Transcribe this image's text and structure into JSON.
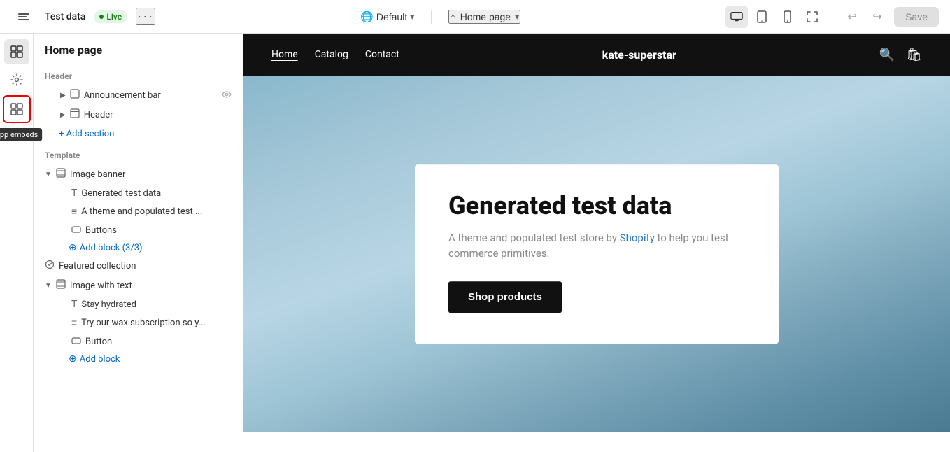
{
  "topbar": {
    "app_name": "Test data",
    "live_label": "Live",
    "more_label": "...",
    "default_label": "Default",
    "home_page_label": "Home page",
    "save_label": "Save"
  },
  "sidebar_icons": [
    {
      "name": "sections-icon",
      "symbol": "⊞",
      "tooltip": null
    },
    {
      "name": "settings-icon",
      "symbol": "⚙",
      "tooltip": null
    },
    {
      "name": "app-embeds-icon",
      "symbol": "⊞",
      "tooltip": "App embeds"
    }
  ],
  "panel": {
    "title": "Home page",
    "sections": {
      "header_label": "Header",
      "items": [
        {
          "id": "announcement-bar",
          "label": "Announcement bar",
          "level": 2,
          "icon": "layout-icon",
          "collapsible": true,
          "action": "visibility-icon"
        },
        {
          "id": "header",
          "label": "Header",
          "level": 2,
          "icon": "layout-icon",
          "collapsible": true
        }
      ],
      "add_section": "Add section",
      "template_label": "Template",
      "template_items": [
        {
          "id": "image-banner",
          "label": "Image banner",
          "level": 1,
          "icon": "section-icon",
          "collapsible": true,
          "expanded": true
        },
        {
          "id": "generated-test-data",
          "label": "Generated test data",
          "level": 2,
          "icon": "text-icon"
        },
        {
          "id": "theme-test",
          "label": "A theme and populated test ...",
          "level": 2,
          "icon": "list-icon"
        },
        {
          "id": "buttons",
          "label": "Buttons",
          "level": 2,
          "icon": "button-icon"
        },
        {
          "id": "add-block",
          "label": "Add block (3/3)",
          "level": 2,
          "type": "add"
        },
        {
          "id": "featured-collection",
          "label": "Featured collection",
          "level": 1,
          "icon": "badge-icon"
        },
        {
          "id": "image-with-text",
          "label": "Image with text",
          "level": 1,
          "icon": "section-icon",
          "collapsible": true,
          "expanded": true
        },
        {
          "id": "stay-hydrated",
          "label": "Stay hydrated",
          "level": 2,
          "icon": "text-icon"
        },
        {
          "id": "try-our-wax",
          "label": "Try our wax subscription so y...",
          "level": 2,
          "icon": "list-icon"
        },
        {
          "id": "button",
          "label": "Button",
          "level": 2,
          "icon": "button-icon"
        },
        {
          "id": "add-block2",
          "label": "Add block",
          "level": 2,
          "type": "add"
        }
      ]
    }
  },
  "store": {
    "nav_links": [
      {
        "label": "Home",
        "active": true
      },
      {
        "label": "Catalog",
        "active": false
      },
      {
        "label": "Contact",
        "active": false
      }
    ],
    "brand": "kate-superstar",
    "banner": {
      "title": "Generated test data",
      "subtitle_parts": [
        {
          "text": "A theme and popu",
          "highlight": false
        },
        {
          "text": "lated test store by ",
          "highlight": false
        },
        {
          "text": "Shopify",
          "highlight": true
        },
        {
          "text": " to help you test commerce primitives.",
          "highlight": false
        }
      ],
      "subtitle_plain": "A theme and populated test store by Shopify to help you test commerce primitives.",
      "cta_label": "Shop products"
    }
  }
}
